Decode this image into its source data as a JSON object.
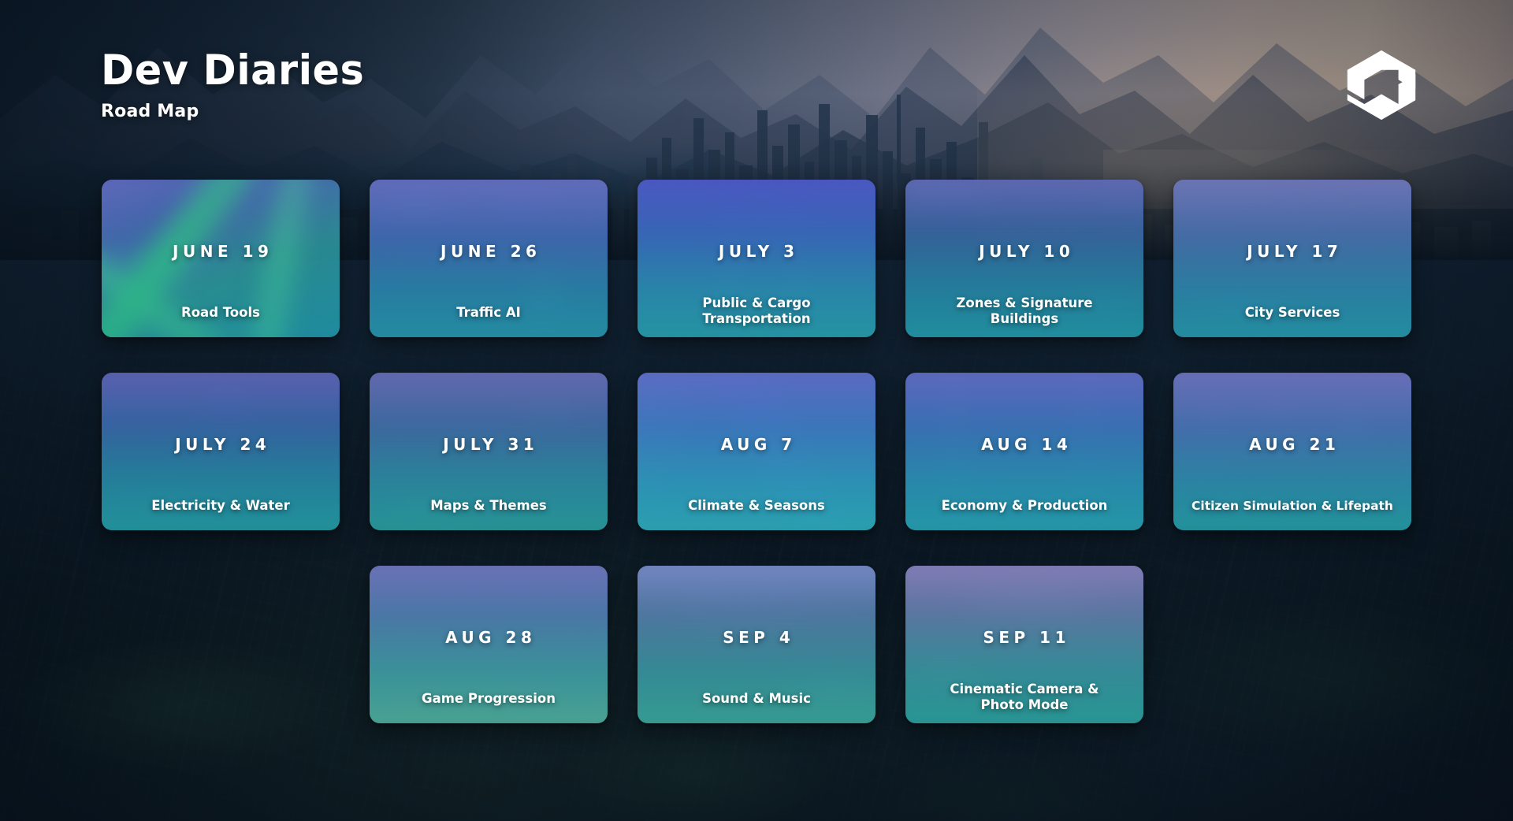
{
  "header": {
    "title": "Dev Diaries",
    "subtitle": "Road Map",
    "logo_name": "colossal-order-hex-logo"
  },
  "colors": {
    "accent_green": "#2fae7d",
    "accent_teal": "#2aa6b5",
    "accent_blue": "#4a5fc1",
    "card_text": "#ffffff",
    "page_bg": "#0a1622"
  },
  "roadmap": {
    "rows": [
      {
        "cards": [
          {
            "date": "JUNE 19",
            "title": "Road Tools",
            "art": "road-tools-art",
            "art_top": "#6d6fc0",
            "art_mid": "#2f9d86",
            "art_bot": "#1f8fa8",
            "highlight": true
          },
          {
            "date": "JUNE 26",
            "title": "Traffic AI",
            "art": "traffic-ai-art",
            "art_top": "#6f74c4",
            "art_mid": "#3d6fb8",
            "art_bot": "#2a93ac",
            "highlight": false
          },
          {
            "date": "JULY 3",
            "title": "Public & Cargo\nTransportation",
            "art": "public-cargo-transportation-art",
            "art_top": "#5a5fcc",
            "art_mid": "#3a7fc4",
            "art_bot": "#2a9db0",
            "highlight": false
          },
          {
            "date": "JULY 10",
            "title": "Zones & Signature\nBuildings",
            "art": "zones-signature-buildings-art",
            "art_top": "#6b6fb8",
            "art_mid": "#35719f",
            "art_bot": "#229aa8",
            "highlight": false
          },
          {
            "date": "JULY 17",
            "title": "City Services",
            "art": "city-services-art",
            "art_top": "#7a7fb8",
            "art_mid": "#4a7fae",
            "art_bot": "#2b9aad",
            "highlight": false
          }
        ]
      },
      {
        "cards": [
          {
            "date": "JULY 24",
            "title": "Electricity & Water",
            "art": "electricity-water-art",
            "art_top": "#6a68b4",
            "art_mid": "#3a6fa8",
            "art_bot": "#2a9fa4",
            "highlight": false
          },
          {
            "date": "JULY 31",
            "title": "Maps & Themes",
            "art": "maps-themes-art",
            "art_top": "#7470b4",
            "art_mid": "#4177a2",
            "art_bot": "#2f9d9c",
            "highlight": false
          },
          {
            "date": "AUG 7",
            "title": "Climate & Seasons",
            "art": "climate-seasons-art",
            "art_top": "#6b70c8",
            "art_mid": "#3e86c4",
            "art_bot": "#34b3c0",
            "highlight": false
          },
          {
            "date": "AUG 14",
            "title": "Economy & Production",
            "art": "economy-production-art",
            "art_top": "#6d6fc6",
            "art_mid": "#3c78b8",
            "art_bot": "#2aa0b2",
            "highlight": false
          },
          {
            "date": "AUG 21",
            "title": "Citizen Simulation & Lifepath",
            "art": "citizen-simulation-lifepath-art",
            "art_top": "#7b77c0",
            "art_mid": "#4a7fb4",
            "art_bot": "#2a9ea6",
            "highlight": false
          }
        ]
      },
      {
        "cards": [
          {
            "date": "AUG 28",
            "title": "Game Progression",
            "art": "game-progression-art",
            "art_top": "#7a76c0",
            "art_mid": "#4f87a8",
            "art_bot": "#55b09a",
            "highlight": false
          },
          {
            "date": "SEP 4",
            "title": "Sound & Music",
            "art": "sound-music-art",
            "art_top": "#8a9ad0",
            "art_mid": "#4f7fa0",
            "art_bot": "#3fa89a",
            "highlight": false
          },
          {
            "date": "SEP 11",
            "title": "Cinematic Camera &\nPhoto Mode",
            "art": "cinematic-camera-photo-mode-art",
            "art_top": "#9a8ec0",
            "art_mid": "#5a80a4",
            "art_bot": "#349f9c",
            "highlight": false
          }
        ]
      }
    ]
  }
}
